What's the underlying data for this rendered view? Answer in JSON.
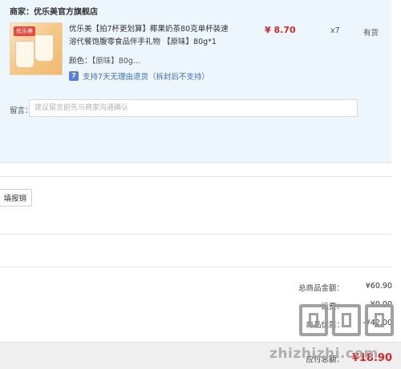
{
  "merchant": {
    "label": "商家：",
    "name": "优乐美官方旗舰店"
  },
  "item": {
    "thumb_tag": "优乐美",
    "title": "优乐美【拍7杯更划算】椰果奶茶80克单杯装速溶代餐饱腹零食品伴手礼物 【原味】80g*1",
    "attr_key": "颜色：",
    "attr_value": "【原味】80g...",
    "guarantee_icon": "7",
    "guarantee": "支持7天无理由退货（拆封后不支持）",
    "price": "¥ 8.70",
    "qty": "x7",
    "stock": "有货"
  },
  "message": {
    "label": "留言：",
    "placeholder": "建议留言前先与商家沟通确认"
  },
  "invoice": {
    "button_label": "填报销"
  },
  "summary": [
    {
      "label": "总商品金额：",
      "value": "¥60.90"
    },
    {
      "label": "运费：",
      "value": "¥0.00"
    },
    {
      "label": "商品优惠：",
      "value": "-¥42.00"
    }
  ],
  "payable": {
    "label": "应付总额：",
    "value": "¥18.90"
  },
  "watermark": {
    "text": "zhizhizhi.com"
  },
  "colors": {
    "accent_red": "#d8262d",
    "link_blue": "#3b6dbf",
    "panel_bg": "#eef6fd"
  }
}
